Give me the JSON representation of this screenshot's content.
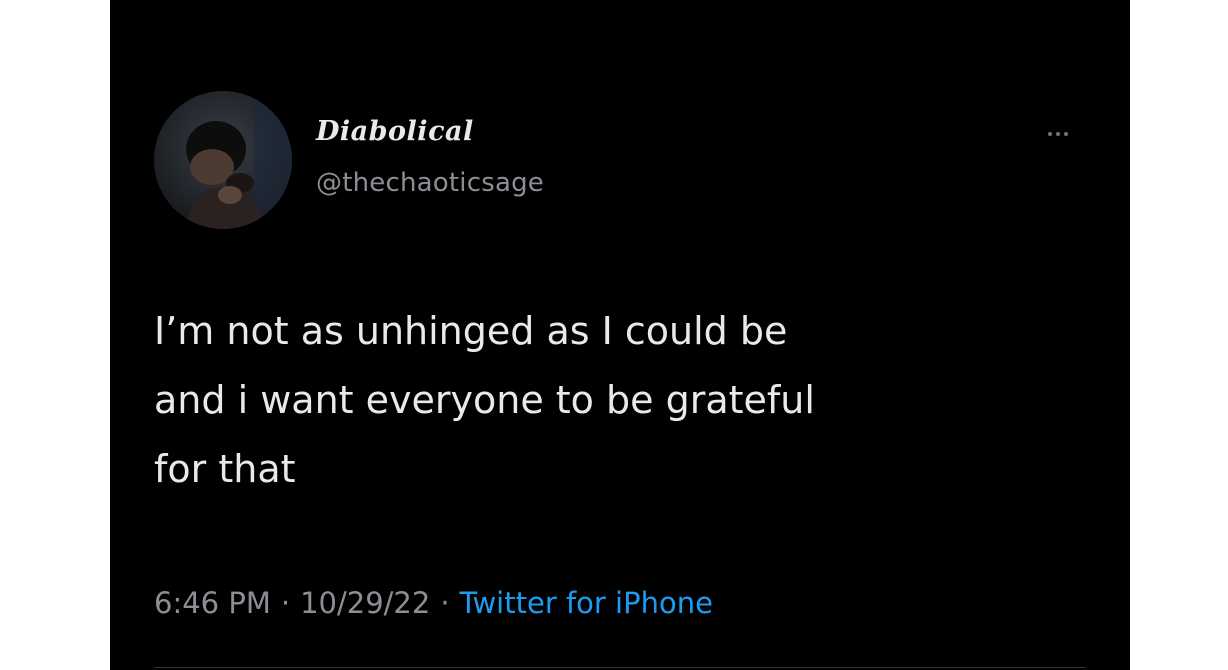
{
  "tweet": {
    "author": {
      "display_name": "Diabolical",
      "handle": "@thechaoticsage"
    },
    "text_lines": [
      "I’m not as unhinged as I could be",
      "and i want everyone to be grateful",
      "for that"
    ],
    "time": "6:46 PM",
    "separator": "·",
    "date": "10/29/22",
    "source": "Twitter for iPhone"
  },
  "colors": {
    "background": "#000000",
    "text": "#e7e9ea",
    "muted": "#8b8f94",
    "link": "#1d9bf0"
  },
  "icons": {
    "more": "more-horizontal-icon"
  }
}
